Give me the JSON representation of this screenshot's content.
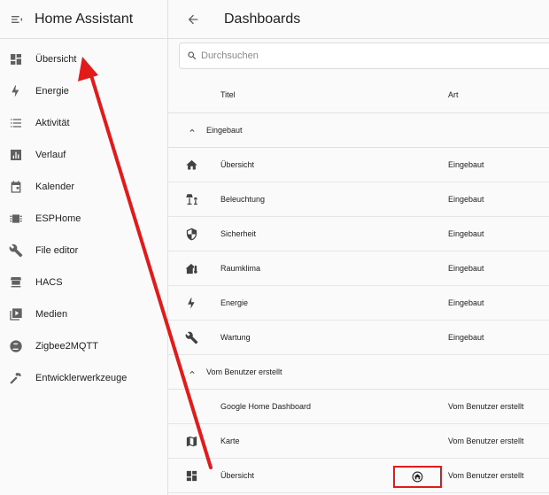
{
  "sidebar": {
    "title": "Home Assistant",
    "items": [
      {
        "label": "Übersicht",
        "icon": "dashboard-icon"
      },
      {
        "label": "Energie",
        "icon": "lightning-icon"
      },
      {
        "label": "Aktivität",
        "icon": "list-icon"
      },
      {
        "label": "Verlauf",
        "icon": "chart-icon"
      },
      {
        "label": "Kalender",
        "icon": "calendar-icon"
      },
      {
        "label": "ESPHome",
        "icon": "chip-icon"
      },
      {
        "label": "File editor",
        "icon": "wrench-icon"
      },
      {
        "label": "HACS",
        "icon": "hacs-icon"
      },
      {
        "label": "Medien",
        "icon": "play-icon"
      },
      {
        "label": "Zigbee2MQTT",
        "icon": "zigbee-icon"
      },
      {
        "label": "Entwicklerwerkzeuge",
        "icon": "hammer-icon"
      }
    ]
  },
  "main": {
    "title": "Dashboards",
    "search_placeholder": "Durchsuchen",
    "columns": {
      "title": "Titel",
      "type": "Art"
    },
    "groups": [
      {
        "label": "Eingebaut",
        "rows": [
          {
            "title": "Übersicht",
            "type": "Eingebaut",
            "icon": "home-icon"
          },
          {
            "title": "Beleuchtung",
            "type": "Eingebaut",
            "icon": "lamps-icon"
          },
          {
            "title": "Sicherheit",
            "type": "Eingebaut",
            "icon": "shield-icon"
          },
          {
            "title": "Raumklima",
            "type": "Eingebaut",
            "icon": "home-thermometer-icon"
          },
          {
            "title": "Energie",
            "type": "Eingebaut",
            "icon": "lightning-icon"
          },
          {
            "title": "Wartung",
            "type": "Eingebaut",
            "icon": "wrench-icon"
          }
        ]
      },
      {
        "label": "Vom Benutzer erstellt",
        "rows": [
          {
            "title": "Google Home Dashboard",
            "type": "Vom Benutzer erstellt",
            "icon": ""
          },
          {
            "title": "Karte",
            "type": "Vom Benutzer erstellt",
            "icon": "map-icon"
          },
          {
            "title": "Übersicht",
            "type": "Vom Benutzer erstellt",
            "icon": "dashboard-icon",
            "default": true
          }
        ]
      }
    ]
  },
  "colors": {
    "annotation_red": "#e21a1a",
    "icon_gray": "#616161",
    "divider": "#e0e0e0"
  }
}
